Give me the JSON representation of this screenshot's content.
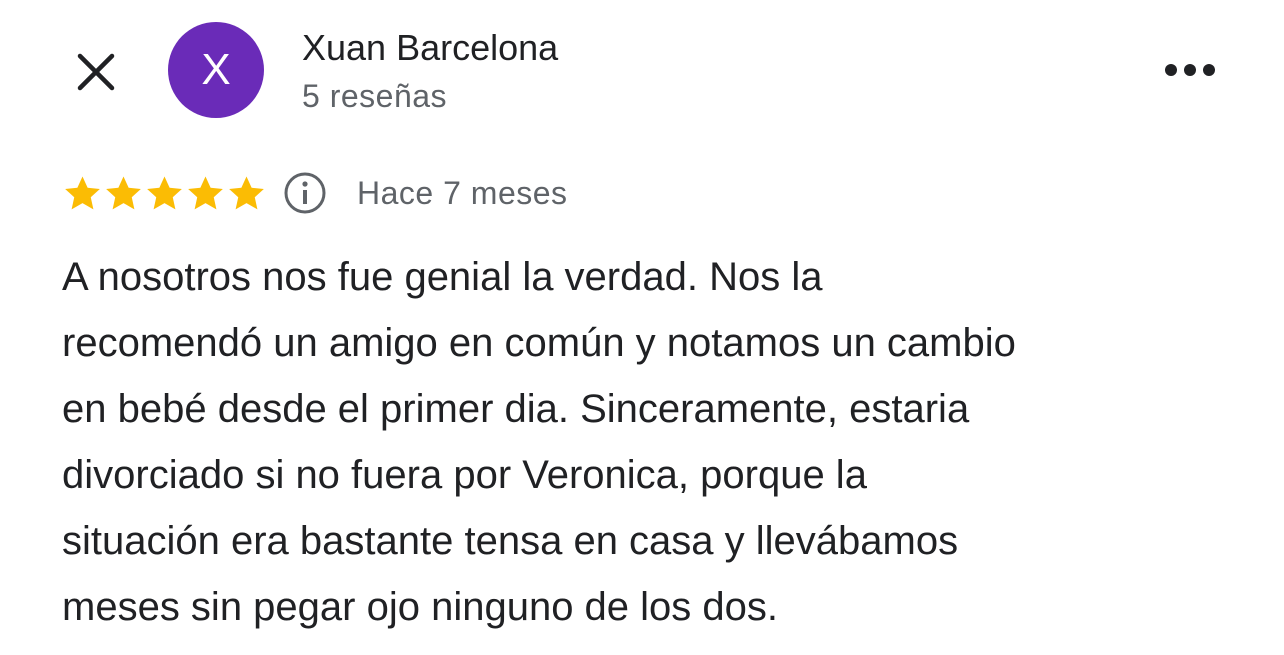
{
  "header": {
    "close_icon": "close-icon",
    "avatar_letter": "X",
    "avatar_color": "#6a2bb8",
    "reviewer_name": "Xuan Barcelona",
    "review_count": "5 reseñas",
    "more_icon": "more-horizontal-icon"
  },
  "review": {
    "rating": 5,
    "rating_max": 5,
    "star_color": "#fbbc04",
    "info_icon": "info-icon",
    "date": "Hace 7 meses",
    "lines": [
      "A nosotros nos fue genial la verdad. Nos la",
      "recomendó un amigo en común y notamos un cambio",
      "en bebé desde el primer dia. Sinceramente, estaria",
      "divorciado si no fuera por Veronica, porque la",
      "situación era bastante tensa en casa y llevábamos",
      "meses sin pegar ojo ninguno de los dos."
    ]
  }
}
